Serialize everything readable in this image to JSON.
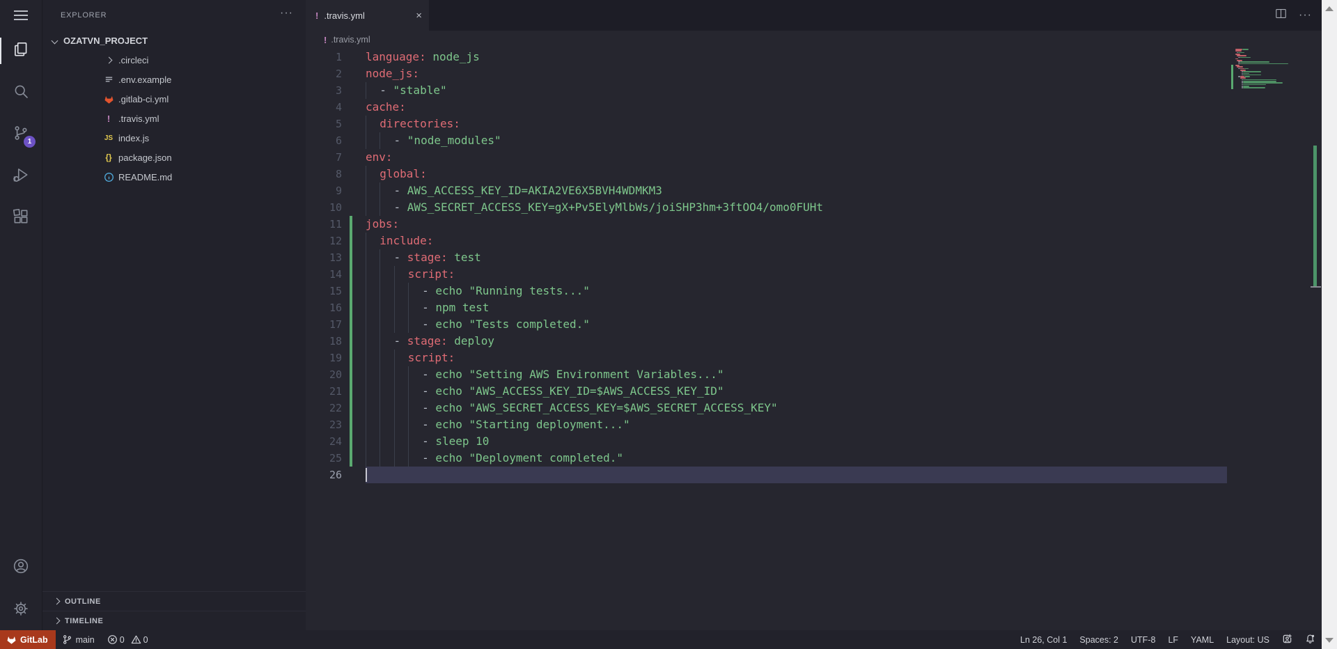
{
  "colors": {
    "key": "#e06c75",
    "value": "#7ec78c",
    "punct": "#b9bfc9",
    "modified_green": "#5aa970",
    "badge_purple": "#6d52c5",
    "gitlab_orange": "#a8391c",
    "travis_pink": "#c586c0",
    "js_yellow": "#e2c94f",
    "info_blue": "#4fa8d8",
    "current_line": "#3a3a52"
  },
  "activity_bar": {
    "items": [
      {
        "name": "menu",
        "icon": "hamburger-icon",
        "active": false
      },
      {
        "name": "explorer",
        "icon": "files-icon",
        "active": true
      },
      {
        "name": "search",
        "icon": "search-icon",
        "active": false
      },
      {
        "name": "source-control",
        "icon": "source-control-icon",
        "active": false,
        "badge": "1"
      },
      {
        "name": "run-debug",
        "icon": "run-debug-icon",
        "active": false
      },
      {
        "name": "extensions",
        "icon": "extensions-icon",
        "active": false
      }
    ],
    "bottom": [
      {
        "name": "account",
        "icon": "account-icon"
      },
      {
        "name": "settings",
        "icon": "gear-icon"
      }
    ]
  },
  "sidebar": {
    "title": "EXPLORER",
    "more_label": "···",
    "root": "OZATVN_PROJECT",
    "files": [
      {
        "name": ".circleci",
        "icon": "chevron-right-icon",
        "kind": "folder"
      },
      {
        "name": ".env.example",
        "icon": "env-icon",
        "kind": "file"
      },
      {
        "name": ".gitlab-ci.yml",
        "icon": "gitlab-icon",
        "kind": "file"
      },
      {
        "name": ".travis.yml",
        "icon": "travis-icon",
        "kind": "file"
      },
      {
        "name": "index.js",
        "icon": "js-icon",
        "kind": "file"
      },
      {
        "name": "package.json",
        "icon": "braces-icon",
        "kind": "file"
      },
      {
        "name": "README.md",
        "icon": "info-icon",
        "kind": "file"
      }
    ],
    "sections": [
      "OUTLINE",
      "TIMELINE"
    ]
  },
  "tabbar": {
    "tab": {
      "label": ".travis.yml",
      "icon": "travis-icon",
      "close": "×"
    },
    "more_label": "···"
  },
  "breadcrumb": {
    "icon": "travis-icon",
    "file": ".travis.yml"
  },
  "editor": {
    "language": "yaml",
    "lines": [
      {
        "num": 1,
        "indent": 0,
        "mod": false,
        "parts": [
          {
            "c": "key",
            "t": "language:"
          },
          {
            "c": "value",
            "t": " node_js"
          }
        ]
      },
      {
        "num": 2,
        "indent": 0,
        "mod": false,
        "parts": [
          {
            "c": "key",
            "t": "node_js:"
          }
        ]
      },
      {
        "num": 3,
        "indent": 1,
        "mod": false,
        "parts": [
          {
            "c": "punct",
            "t": "- "
          },
          {
            "c": "value",
            "t": "\"stable\""
          }
        ]
      },
      {
        "num": 4,
        "indent": 0,
        "mod": false,
        "parts": [
          {
            "c": "key",
            "t": "cache:"
          }
        ]
      },
      {
        "num": 5,
        "indent": 1,
        "mod": false,
        "parts": [
          {
            "c": "key",
            "t": "directories:"
          }
        ]
      },
      {
        "num": 6,
        "indent": 2,
        "mod": false,
        "parts": [
          {
            "c": "punct",
            "t": "- "
          },
          {
            "c": "value",
            "t": "\"node_modules\""
          }
        ]
      },
      {
        "num": 7,
        "indent": 0,
        "mod": false,
        "parts": [
          {
            "c": "key",
            "t": "env:"
          }
        ]
      },
      {
        "num": 8,
        "indent": 1,
        "mod": false,
        "parts": [
          {
            "c": "key",
            "t": "global:"
          }
        ]
      },
      {
        "num": 9,
        "indent": 2,
        "mod": false,
        "parts": [
          {
            "c": "punct",
            "t": "- "
          },
          {
            "c": "value",
            "t": "AWS_ACCESS_KEY_ID=AKIA2VE6X5BVH4WDMKM3"
          }
        ]
      },
      {
        "num": 10,
        "indent": 2,
        "mod": false,
        "parts": [
          {
            "c": "punct",
            "t": "- "
          },
          {
            "c": "value",
            "t": "AWS_SECRET_ACCESS_KEY=gX+Pv5ElyMlbWs/joiSHP3hm+3ftOO4/omo0FUHt"
          }
        ]
      },
      {
        "num": 11,
        "indent": 0,
        "mod": true,
        "parts": [
          {
            "c": "key",
            "t": "jobs:"
          }
        ]
      },
      {
        "num": 12,
        "indent": 1,
        "mod": true,
        "parts": [
          {
            "c": "key",
            "t": "include:"
          }
        ]
      },
      {
        "num": 13,
        "indent": 2,
        "mod": true,
        "parts": [
          {
            "c": "punct",
            "t": "- "
          },
          {
            "c": "key",
            "t": "stage:"
          },
          {
            "c": "value",
            "t": " test"
          }
        ]
      },
      {
        "num": 14,
        "indent": 3,
        "mod": true,
        "parts": [
          {
            "c": "key",
            "t": "script:"
          }
        ]
      },
      {
        "num": 15,
        "indent": 4,
        "mod": true,
        "parts": [
          {
            "c": "punct",
            "t": "- "
          },
          {
            "c": "value",
            "t": "echo \"Running tests...\""
          }
        ]
      },
      {
        "num": 16,
        "indent": 4,
        "mod": true,
        "parts": [
          {
            "c": "punct",
            "t": "- "
          },
          {
            "c": "value",
            "t": "npm test"
          }
        ]
      },
      {
        "num": 17,
        "indent": 4,
        "mod": true,
        "parts": [
          {
            "c": "punct",
            "t": "- "
          },
          {
            "c": "value",
            "t": "echo \"Tests completed.\""
          }
        ]
      },
      {
        "num": 18,
        "indent": 2,
        "mod": true,
        "parts": [
          {
            "c": "punct",
            "t": "- "
          },
          {
            "c": "key",
            "t": "stage:"
          },
          {
            "c": "value",
            "t": " deploy"
          }
        ]
      },
      {
        "num": 19,
        "indent": 3,
        "mod": true,
        "parts": [
          {
            "c": "key",
            "t": "script:"
          }
        ]
      },
      {
        "num": 20,
        "indent": 4,
        "mod": true,
        "parts": [
          {
            "c": "punct",
            "t": "- "
          },
          {
            "c": "value",
            "t": "echo \"Setting AWS Environment Variables...\""
          }
        ]
      },
      {
        "num": 21,
        "indent": 4,
        "mod": true,
        "parts": [
          {
            "c": "punct",
            "t": "- "
          },
          {
            "c": "value",
            "t": "echo \"AWS_ACCESS_KEY_ID=$AWS_ACCESS_KEY_ID\""
          }
        ]
      },
      {
        "num": 22,
        "indent": 4,
        "mod": true,
        "parts": [
          {
            "c": "punct",
            "t": "- "
          },
          {
            "c": "value",
            "t": "echo \"AWS_SECRET_ACCESS_KEY=$AWS_SECRET_ACCESS_KEY\""
          }
        ]
      },
      {
        "num": 23,
        "indent": 4,
        "mod": true,
        "parts": [
          {
            "c": "punct",
            "t": "- "
          },
          {
            "c": "value",
            "t": "echo \"Starting deployment...\""
          }
        ]
      },
      {
        "num": 24,
        "indent": 4,
        "mod": true,
        "parts": [
          {
            "c": "punct",
            "t": "- "
          },
          {
            "c": "value",
            "t": "sleep 10"
          }
        ]
      },
      {
        "num": 25,
        "indent": 4,
        "mod": true,
        "parts": [
          {
            "c": "punct",
            "t": "- "
          },
          {
            "c": "value",
            "t": "echo \"Deployment completed.\""
          }
        ]
      },
      {
        "num": 26,
        "indent": 0,
        "mod": false,
        "cur": true,
        "parts": []
      }
    ]
  },
  "status_bar": {
    "left": [
      {
        "name": "gitlab",
        "icon": "gitlab-icon",
        "label": "GitLab"
      },
      {
        "name": "branch",
        "icon": "branch-icon",
        "label": "main"
      },
      {
        "name": "problems",
        "error_icon": "error-icon",
        "errors": "0",
        "warning_icon": "warning-icon",
        "warnings": "0"
      }
    ],
    "right": [
      {
        "name": "cursor-position",
        "label": "Ln 26, Col 1"
      },
      {
        "name": "indentation",
        "label": "Spaces: 2"
      },
      {
        "name": "encoding",
        "label": "UTF-8"
      },
      {
        "name": "eol",
        "label": "LF"
      },
      {
        "name": "language-mode",
        "label": "YAML"
      },
      {
        "name": "keyboard-layout",
        "label": "Layout: US"
      },
      {
        "name": "feedback",
        "icon": "person-frame-icon"
      },
      {
        "name": "notifications",
        "icon": "bell-dot-icon"
      }
    ]
  }
}
